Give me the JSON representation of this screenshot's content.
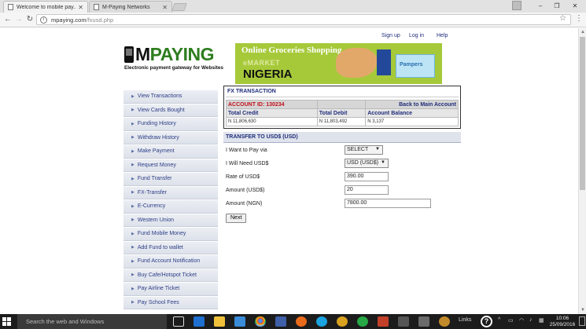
{
  "browser": {
    "tabs": [
      {
        "title": "Welcome to mobile pay...",
        "active": true
      },
      {
        "title": "M-Paying Networks",
        "active": false
      }
    ],
    "url_host": "mpaying.com",
    "url_path": "/fxusd.php"
  },
  "site": {
    "top_links": [
      "Sign up",
      "Log in",
      "Help"
    ],
    "logo_m": "M",
    "logo_rest": "PAYING",
    "logo_tagline": "Electronic payment gateway for Websites",
    "banner": {
      "headline": "Online Groceries Shopping",
      "sub": "eMARKET",
      "big": "NIGERIA",
      "product": "Pampers"
    }
  },
  "sidebar": {
    "items": [
      "View Transactions",
      "View Cards Bought",
      "Funding History",
      "Withdraw History",
      "Make Payment",
      "Request Money",
      "Fund Transfer",
      "FX-Transfer",
      "E-Currency",
      "Western Union",
      "Fund Mobile Money",
      "Add Fund to wallet",
      "Fund Account Notification",
      "Buy Cafe/Hotspot Ticket",
      "Pay Airline Ticket",
      "Pay School Fees"
    ]
  },
  "fx": {
    "title": "FX TRANSACTION",
    "account_id": "ACCOUNT ID: 130234",
    "back_link": "Back to Main Account",
    "labels": {
      "credit": "Total Credit",
      "debit": "Total Debit",
      "balance": "Account Balance"
    },
    "values": {
      "credit": "N 11,806,630",
      "debit": "N 11,803,492",
      "balance": "N 3,137"
    }
  },
  "form": {
    "section_title": "TRANSFER TO USD$ (USD)",
    "pay_via_label": "I Want to Pay via",
    "pay_via_value": "SELECT",
    "need_label": "I Will Need USD$",
    "need_value": "USD (USD$)",
    "rate_label": "Rate of USD$",
    "rate_value": "390.00",
    "amount_usd_label": "Amount (USD$)",
    "amount_usd_value": "20",
    "amount_ngn_label": "Amount (NGN)",
    "amount_ngn_value": "7800.00",
    "next_label": "Next"
  },
  "taskbar": {
    "search_placeholder": "Search the web and Windows",
    "links_label": "Links",
    "time": "10:06",
    "date": "25/09/2016"
  }
}
